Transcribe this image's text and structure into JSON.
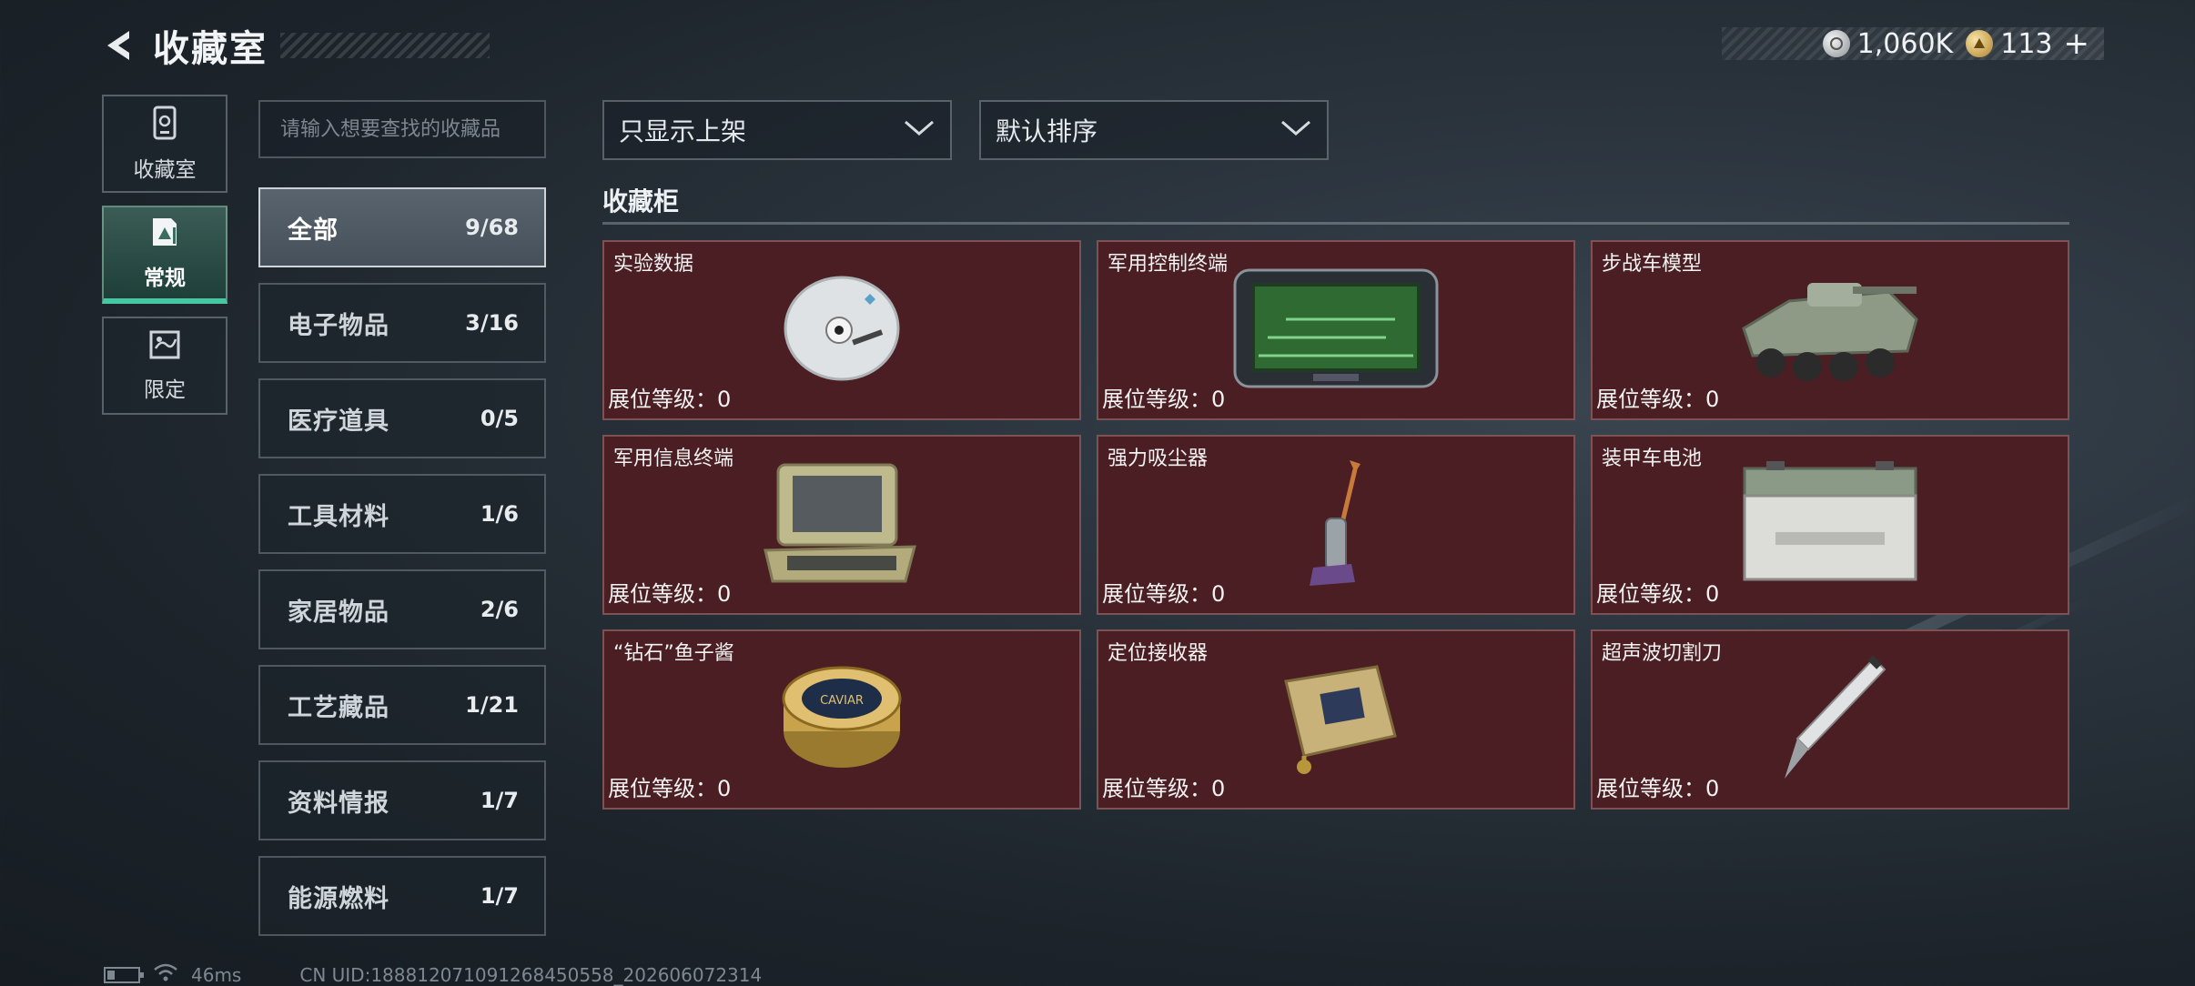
{
  "header": {
    "title": "收藏室",
    "currency_silver": "1,060K",
    "currency_gold": "113"
  },
  "rail": [
    {
      "label": "收藏室",
      "icon": "building-icon",
      "active": false
    },
    {
      "label": "常规",
      "icon": "document-icon",
      "active": true
    },
    {
      "label": "限定",
      "icon": "map-icon",
      "active": false
    }
  ],
  "search": {
    "placeholder": "请输入想要查找的收藏品"
  },
  "categories": [
    {
      "name": "全部",
      "count": "9/68",
      "active": true
    },
    {
      "name": "电子物品",
      "count": "3/16"
    },
    {
      "name": "医疗道具",
      "count": "0/5"
    },
    {
      "name": "工具材料",
      "count": "1/6"
    },
    {
      "name": "家居物品",
      "count": "2/6"
    },
    {
      "name": "工艺藏品",
      "count": "1/21"
    },
    {
      "name": "资料情报",
      "count": "1/7"
    },
    {
      "name": "能源燃料",
      "count": "1/7"
    }
  ],
  "filters": {
    "filter_value": "只显示上架",
    "sort_value": "默认排序"
  },
  "section_title": "收藏柜",
  "items": [
    {
      "name": "实验数据",
      "level": "展位等级：0",
      "icon": "disc-icon"
    },
    {
      "name": "军用控制终端",
      "level": "展位等级：0",
      "icon": "terminal-icon"
    },
    {
      "name": "步战车模型",
      "level": "展位等级：0",
      "icon": "tank-model-icon"
    },
    {
      "name": "军用信息终端",
      "level": "展位等级：0",
      "icon": "laptop-case-icon"
    },
    {
      "name": "强力吸尘器",
      "level": "展位等级：0",
      "icon": "vacuum-icon"
    },
    {
      "name": "装甲车电池",
      "level": "展位等级：0",
      "icon": "battery-icon"
    },
    {
      "name": "“钻石”鱼子酱",
      "level": "展位等级：0",
      "icon": "caviar-tin-icon",
      "label_text": "CAVIAR"
    },
    {
      "name": "定位接收器",
      "level": "展位等级：0",
      "icon": "gps-receiver-icon"
    },
    {
      "name": "超声波切割刀",
      "level": "展位等级：0",
      "icon": "cutter-knife-icon"
    }
  ],
  "footer": {
    "ping": "46ms",
    "uid": "CN UID:18881207109126845055​8_202606072314"
  },
  "colors": {
    "accent": "#46c7a1",
    "card_bg": "#4a1e23",
    "bg": "#1c232a"
  }
}
